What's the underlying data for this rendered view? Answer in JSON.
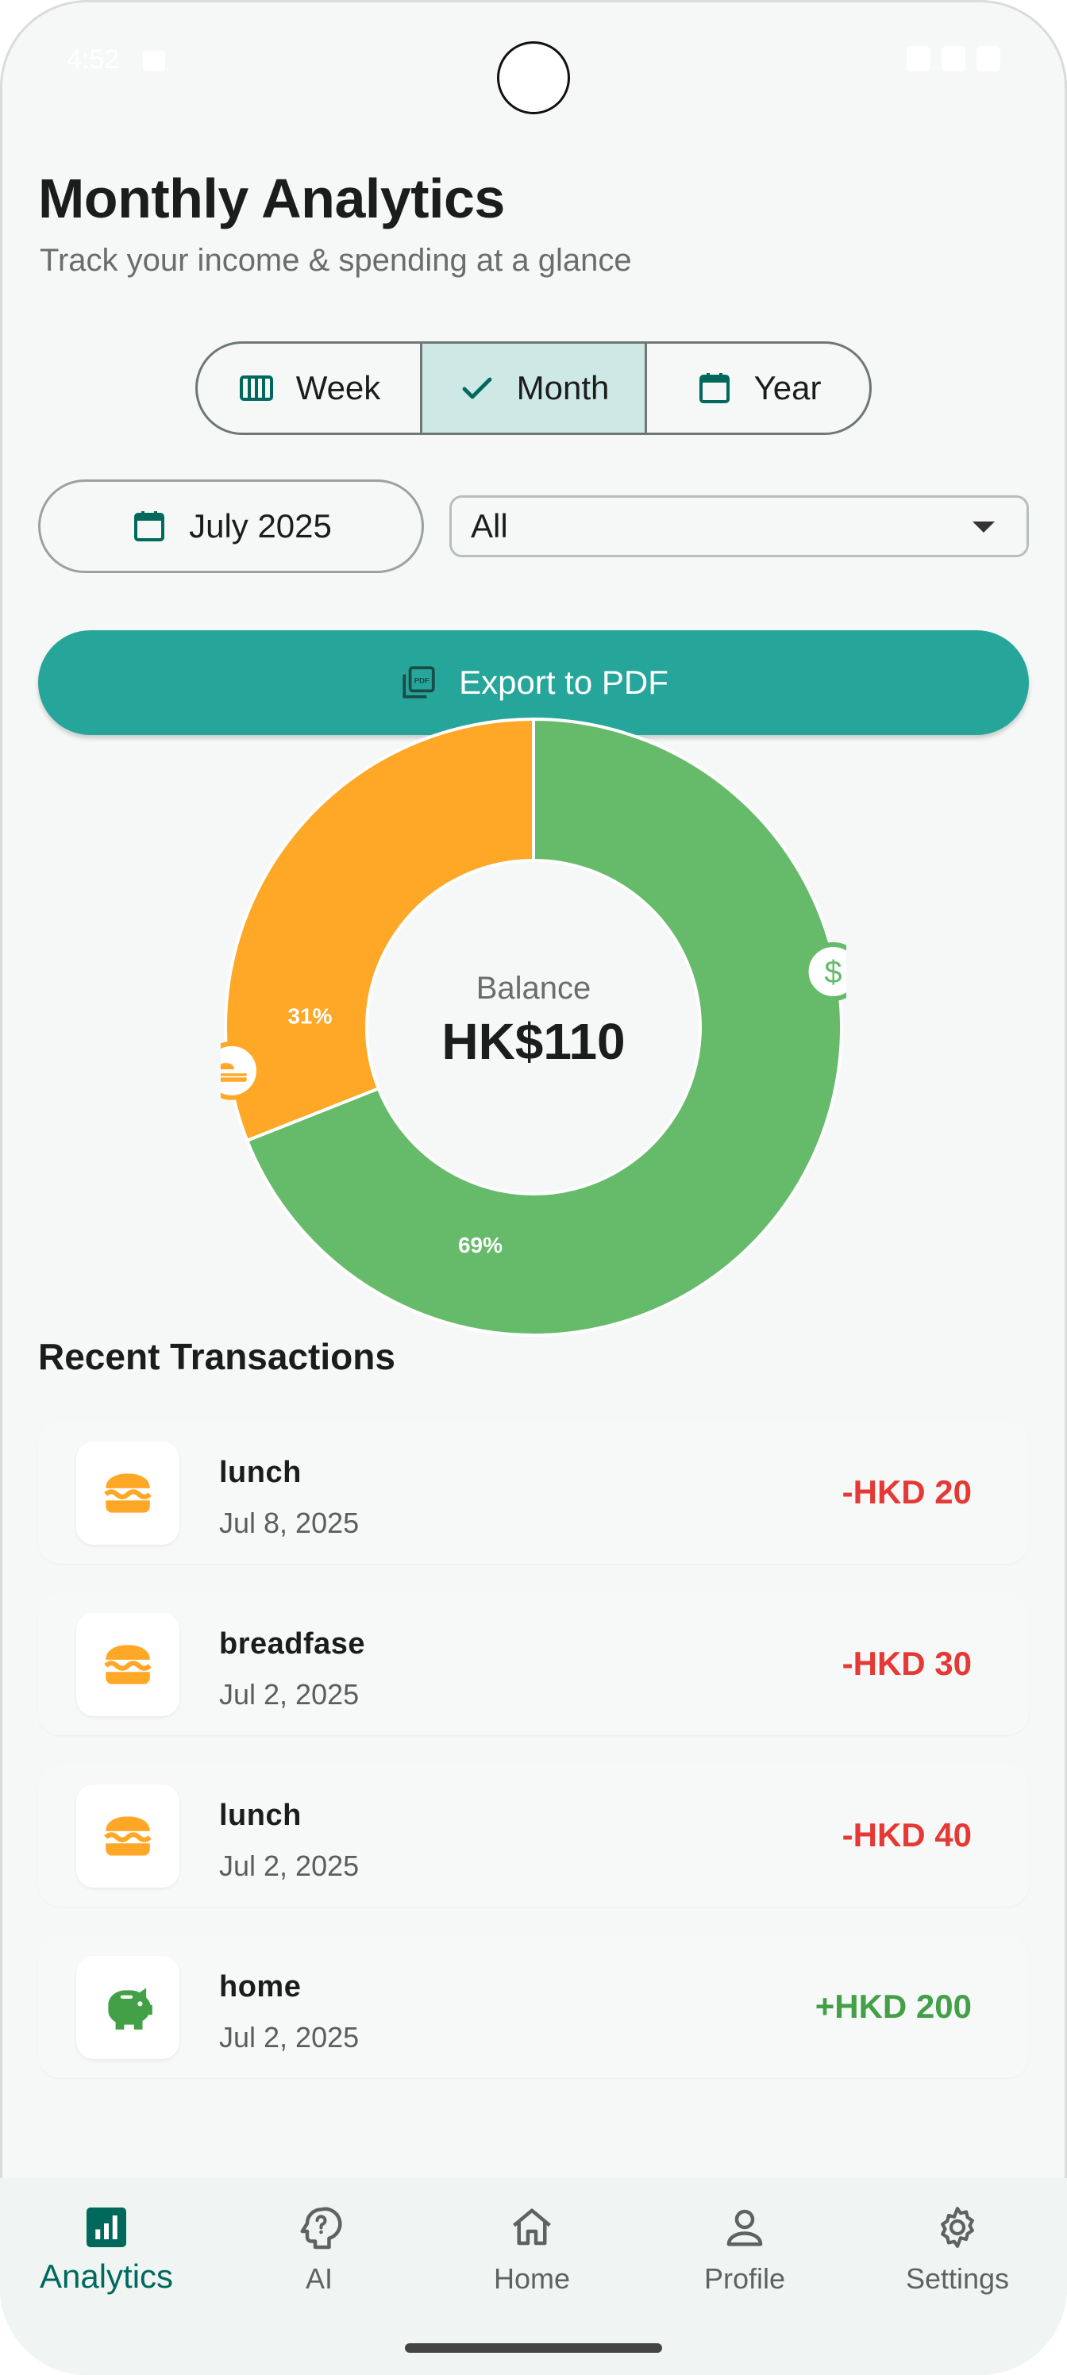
{
  "status": {
    "time": "4:52"
  },
  "header": {
    "title": "Monthly Analytics",
    "subtitle": "Track your income & spending at a glance"
  },
  "period_toggle": {
    "options": [
      {
        "label": "Week",
        "icon": "calendar-view-week-icon"
      },
      {
        "label": "Month",
        "icon": "check-icon",
        "selected": true
      },
      {
        "label": "Year",
        "icon": "calendar-icon"
      }
    ]
  },
  "filters": {
    "date_label": "July 2025",
    "category_value": "All"
  },
  "export": {
    "label": "Export to PDF",
    "icon": "pdf-icon"
  },
  "chart_data": {
    "type": "pie",
    "categories": [
      "Food",
      "Income"
    ],
    "values": [
      31,
      69
    ],
    "labels": [
      "31%",
      "69%"
    ],
    "colors": [
      "#ffa726",
      "#66bb6a"
    ],
    "center_label": "Balance",
    "center_value": "HK$110"
  },
  "transactions": {
    "title": "Recent Transactions",
    "items": [
      {
        "name": "lunch",
        "date": "Jul 8, 2025",
        "amount": "-HKD 20",
        "type": "expense",
        "icon": "burger-icon"
      },
      {
        "name": "breadfase",
        "date": "Jul 2, 2025",
        "amount": "-HKD 30",
        "type": "expense",
        "icon": "burger-icon"
      },
      {
        "name": "lunch",
        "date": "Jul 2, 2025",
        "amount": "-HKD 40",
        "type": "expense",
        "icon": "burger-icon"
      },
      {
        "name": "home",
        "date": "Jul 2, 2025",
        "amount": "+HKD 200",
        "type": "income",
        "icon": "piggy-bank-icon"
      }
    ]
  },
  "nav": {
    "items": [
      {
        "label": "Analytics",
        "icon": "analytics-icon",
        "active": true
      },
      {
        "label": "AI",
        "icon": "ai-icon"
      },
      {
        "label": "Home",
        "icon": "home-icon"
      },
      {
        "label": "Profile",
        "icon": "profile-icon"
      },
      {
        "label": "Settings",
        "icon": "settings-icon"
      }
    ]
  },
  "colors": {
    "accent": "#26a69a",
    "expense": "#e53935",
    "income": "#43a047",
    "food": "#ffa726"
  }
}
